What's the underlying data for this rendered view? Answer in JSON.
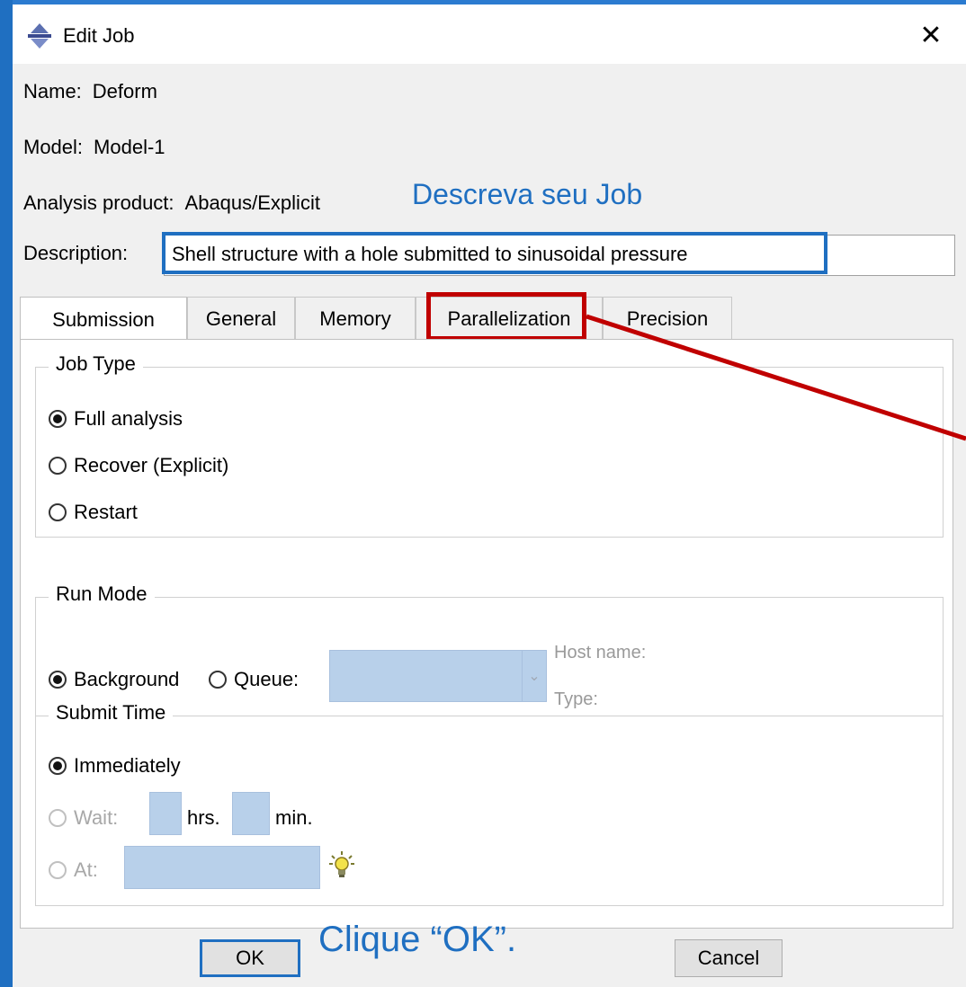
{
  "window": {
    "title": "Edit Job",
    "close_glyph": "✕",
    "icon": "abaqus-job-icon"
  },
  "info": {
    "name_label": "Name:",
    "name_value": "Deform",
    "model_label": "Model:",
    "model_value": "Model-1",
    "product_label": "Analysis product:",
    "product_value": "Abaqus/Explicit",
    "description_label": "Description:",
    "description_value": "Shell structure with a hole submitted to sinusoidal pressure"
  },
  "annotations": {
    "describe_job": "Descreva seu Job",
    "click_ok": "Clique “OK”.",
    "highlight_color": "#1f6fc1",
    "arrow_color": "#c00000"
  },
  "tabs": [
    {
      "label": "Submission",
      "active": true
    },
    {
      "label": "General",
      "active": false
    },
    {
      "label": "Memory",
      "active": false
    },
    {
      "label": "Parallelization",
      "active": false,
      "highlighted": true
    },
    {
      "label": "Precision",
      "active": false
    }
  ],
  "job_type": {
    "title": "Job Type",
    "options": [
      {
        "label": "Full analysis",
        "selected": true
      },
      {
        "label": "Recover (Explicit)",
        "selected": false
      },
      {
        "label": "Restart",
        "selected": false
      }
    ]
  },
  "run_mode": {
    "title": "Run Mode",
    "background_label": "Background",
    "background_selected": true,
    "queue_label": "Queue:",
    "queue_selected": false,
    "host_name_label": "Host name:",
    "type_label": "Type:"
  },
  "submit_time": {
    "title": "Submit Time",
    "immediately_label": "Immediately",
    "immediately_selected": true,
    "wait_label": "Wait:",
    "hrs_label": "hrs.",
    "min_label": "min.",
    "at_label": "At:",
    "hint_icon": "lightbulb-icon"
  },
  "buttons": {
    "ok": "OK",
    "cancel": "Cancel"
  }
}
